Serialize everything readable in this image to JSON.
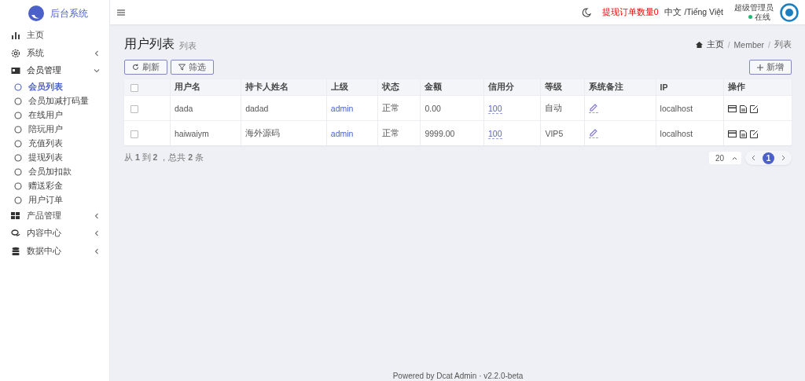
{
  "brand": {
    "title": "后台系统"
  },
  "sidebar": {
    "items": [
      {
        "label": "主页"
      },
      {
        "label": "系统",
        "expanded": false
      },
      {
        "label": "会员管理",
        "expanded": true,
        "children": [
          {
            "label": "会员列表",
            "selected": true
          },
          {
            "label": "会员加减打码量",
            "selected": false
          },
          {
            "label": "在线用户",
            "selected": false
          },
          {
            "label": "陪玩用户",
            "selected": false
          },
          {
            "label": "充值列表",
            "selected": false
          },
          {
            "label": "提现列表",
            "selected": false
          },
          {
            "label": "会员加扣款",
            "selected": false
          },
          {
            "label": "赠送彩金",
            "selected": false
          },
          {
            "label": "用户订单",
            "selected": false
          }
        ]
      },
      {
        "label": "产品管理",
        "expanded": false
      },
      {
        "label": "内容中心",
        "expanded": false
      },
      {
        "label": "数据中心",
        "expanded": false
      }
    ]
  },
  "header": {
    "alert": "提现订单数量0",
    "language": "中文 /Tiếng Việt",
    "user": "超级管理员",
    "status": "在线"
  },
  "page": {
    "title": "用户列表",
    "subtitle": "列表",
    "breadcrumb": [
      "主页",
      "Member",
      "列表"
    ],
    "separator": "/"
  },
  "toolbar": {
    "refresh": "刷新",
    "filter": "筛选",
    "create": "新增"
  },
  "table": {
    "all_checked": false,
    "columns": [
      "用户名",
      "持卡人姓名",
      "上级",
      "状态",
      "金额",
      "信用分",
      "等级",
      "系统备注",
      "IP",
      "操作"
    ],
    "rows": [
      {
        "checked": false,
        "username": "dada",
        "holder": "dadad",
        "parent": "admin",
        "status": "正常",
        "amount": "0.00",
        "credit": "100",
        "level": "自动",
        "ip": "localhost"
      },
      {
        "checked": false,
        "username": "haiwaiym",
        "holder": "海外源码",
        "parent": "admin",
        "status": "正常",
        "amount": "9999.00",
        "credit": "100",
        "level": "VIP5",
        "ip": "localhost"
      }
    ]
  },
  "pagination": {
    "summary": "从 **1** 到 **2** ，总共 **2** 条",
    "per_page": "20",
    "pages": [
      {
        "label": "1",
        "selected": true
      }
    ]
  },
  "footer": "Powered by Dcat Admin · v2.2.0-beta"
}
